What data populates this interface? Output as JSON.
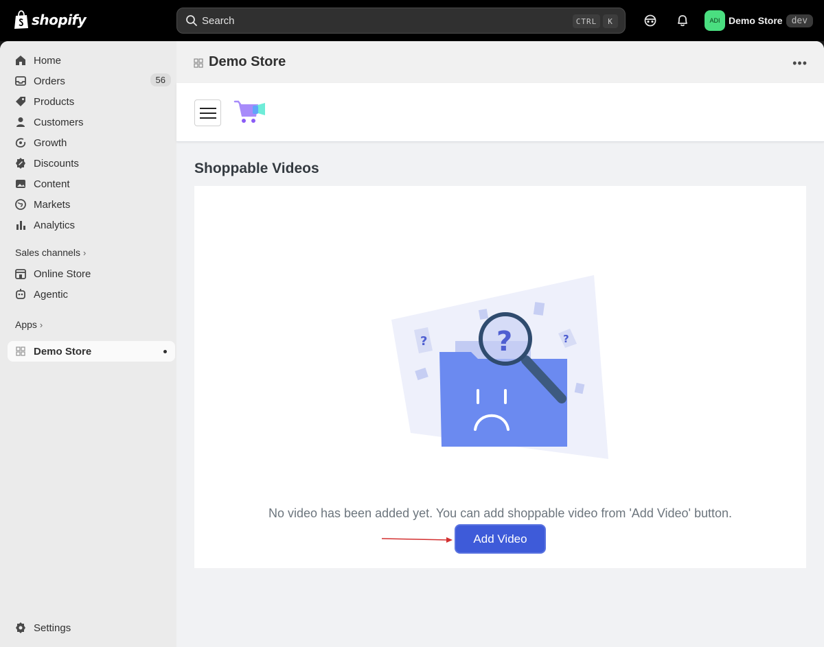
{
  "topbar": {
    "logo_text": "shopify",
    "search_placeholder": "Search",
    "shortcut_ctrl": "CTRL",
    "shortcut_key": "K",
    "avatar_initials": "ADI",
    "store_name": "Demo Store",
    "env_badge": "dev"
  },
  "sidebar": {
    "items": [
      {
        "label": "Home",
        "icon": "home-icon"
      },
      {
        "label": "Orders",
        "icon": "inbox-icon",
        "count": "56"
      },
      {
        "label": "Products",
        "icon": "tag-icon"
      },
      {
        "label": "Customers",
        "icon": "person-icon"
      },
      {
        "label": "Growth",
        "icon": "growth-icon"
      },
      {
        "label": "Discounts",
        "icon": "discount-icon"
      },
      {
        "label": "Content",
        "icon": "image-icon"
      },
      {
        "label": "Markets",
        "icon": "globe-icon"
      },
      {
        "label": "Analytics",
        "icon": "bar-chart-icon"
      }
    ],
    "sales_channels_label": "Sales channels",
    "sales_channels": [
      {
        "label": "Online Store",
        "icon": "store-icon"
      },
      {
        "label": "Agentic",
        "icon": "agentic-icon"
      }
    ],
    "apps_label": "Apps",
    "active_app": "Demo Store",
    "settings_label": "Settings"
  },
  "page": {
    "title": "Demo Store",
    "more_label": "•••"
  },
  "app": {
    "section_title": "Shoppable Videos",
    "empty_message": "No video has been added yet. You can add shoppable video from 'Add Video' button.",
    "add_button": "Add Video"
  },
  "colors": {
    "primary_button": "#3e5bd9",
    "avatar_bg": "#4ade80",
    "annotation_arrow": "#d32f2f"
  }
}
